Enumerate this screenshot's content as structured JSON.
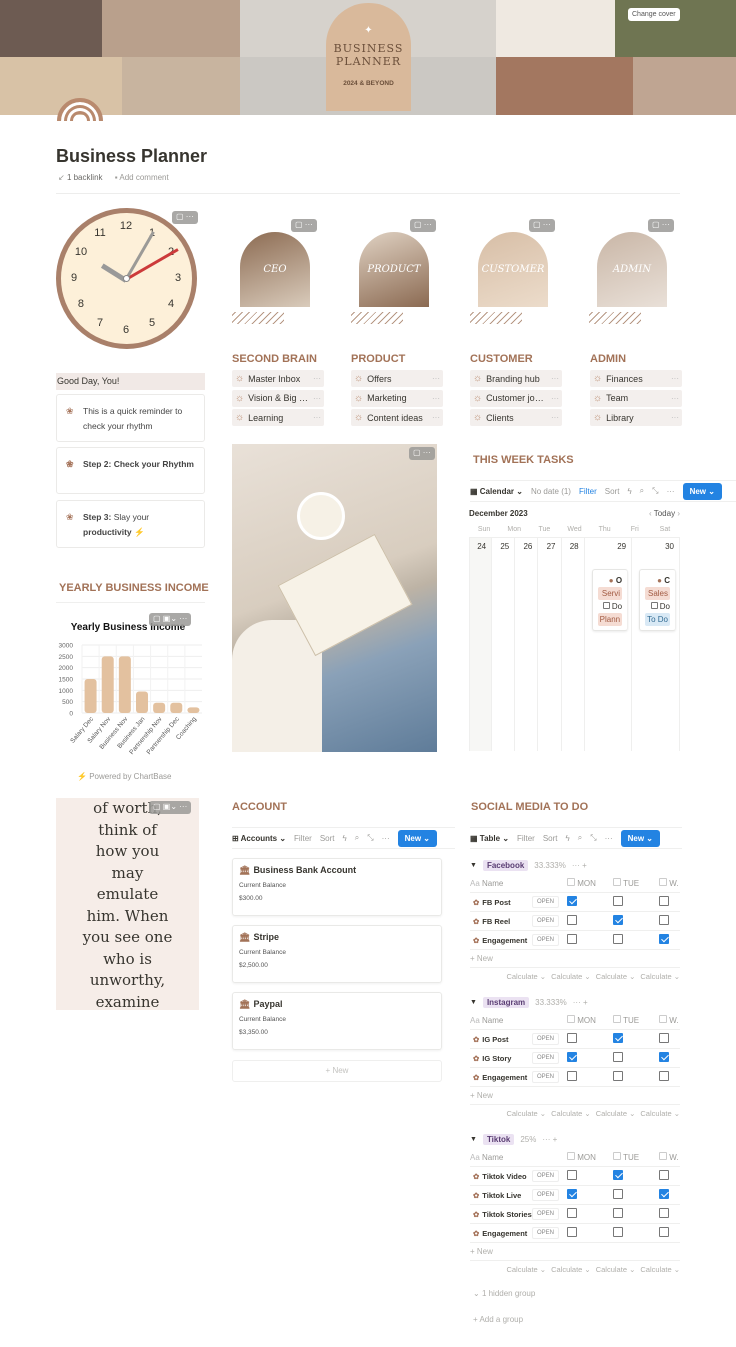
{
  "cover": {
    "badge_title": "BUSINESS PLANNER",
    "badge_subtitle": "2024 & BEYOND",
    "change_cover": "Change cover"
  },
  "page": {
    "title": "Business Planner",
    "backlinks": "1 backlink",
    "add_comment": "Add comment"
  },
  "clock": {
    "numbers": [
      "12",
      "1",
      "2",
      "3",
      "4",
      "5",
      "6",
      "7",
      "8",
      "9",
      "10",
      "11"
    ]
  },
  "categories": [
    {
      "image_label": "CEO",
      "heading": "SECOND BRAIN",
      "items": [
        "Master Inbox",
        "Vision & Big Goals",
        "Learning"
      ]
    },
    {
      "image_label": "PRODUCT",
      "heading": "PRODUCT",
      "items": [
        "Offers",
        "Marketing",
        "Content ideas"
      ]
    },
    {
      "image_label": "CUSTOMER",
      "heading": "CUSTOMER",
      "items": [
        "Branding hub",
        "Customer journey",
        "Clients"
      ]
    },
    {
      "image_label": "ADMIN",
      "heading": "ADMIN",
      "items": [
        "Finances",
        "Team",
        "Library"
      ]
    }
  ],
  "greeting": {
    "title": "Good Day, You!",
    "cards": [
      {
        "text": "This is a quick reminder to check your rhythm"
      },
      {
        "bold": "Step 2: Check your Rhythm"
      },
      {
        "bold": "Step 3:",
        "text": " Slay your ",
        "bold2": "productivity",
        "emoji": "⚡"
      }
    ]
  },
  "tasks": {
    "heading": "THIS WEEK TASKS",
    "view": "Calendar",
    "no_date": "No date (1)",
    "filter": "Filter",
    "sort": "Sort",
    "new": "New",
    "month": "December 2023",
    "today": "Today",
    "weekdays": [
      "Sun",
      "Mon",
      "Tue",
      "Wed",
      "Thu",
      "Fri",
      "Sat"
    ],
    "dates": [
      "24",
      "25",
      "26",
      "27",
      "28",
      "29",
      "30"
    ],
    "events": [
      {
        "day": "29",
        "title": "O",
        "tag": "Servi",
        "todo": "Do",
        "status": "Plann"
      },
      {
        "day": "30",
        "title": "C",
        "tag": "Sales",
        "todo": "Do",
        "status": "To Do"
      }
    ]
  },
  "income": {
    "heading": "YEARLY BUSINESS INCOME",
    "powered": "Powered by ChartBase"
  },
  "chart_data": {
    "type": "bar",
    "title": "Yearly Business Income",
    "categories": [
      "Salary Dec",
      "Salary Nov",
      "Business Nov",
      "Business Jan",
      "Partnership Nov",
      "Partnership Dec",
      "Coaching"
    ],
    "values": [
      1500,
      2500,
      2500,
      950,
      450,
      450,
      250
    ],
    "ylim": [
      0,
      3000
    ],
    "yticks": [
      0,
      500,
      1000,
      1500,
      2000,
      2500,
      3000
    ],
    "grid": true,
    "color": "#e3c19f"
  },
  "quote": {
    "lines": [
      "of worth,",
      "think of",
      "how you",
      "may",
      "emulate",
      "him. When",
      "you see one",
      "who is",
      "unworthy,",
      "examine"
    ]
  },
  "account": {
    "heading": "ACCOUNT",
    "view": "Accounts",
    "filter": "Filter",
    "sort": "Sort",
    "new": "New",
    "new_row": "+ New",
    "cards": [
      {
        "name": "Business Bank Account",
        "label": "Current Balance",
        "value": "$300.00"
      },
      {
        "name": "Stripe",
        "label": "Current Balance",
        "value": "$2,500.00"
      },
      {
        "name": "Paypal",
        "label": "Current Balance",
        "value": "$3,350.00"
      }
    ]
  },
  "social": {
    "heading": "SOCIAL MEDIA TO DO",
    "view": "Table",
    "filter": "Filter",
    "sort": "Sort",
    "new": "New",
    "col_name": "Name",
    "cols": [
      "MON",
      "TUE",
      "W."
    ],
    "open": "OPEN",
    "add_new": "+ New",
    "calculate": "Calculate ⌄",
    "hidden_group": "1 hidden group",
    "add_group": "Add a group",
    "groups": [
      {
        "name": "Facebook",
        "percent": "33.333%",
        "rows": [
          {
            "name": "FB Post",
            "checks": [
              true,
              false,
              false
            ]
          },
          {
            "name": "FB Reel",
            "checks": [
              false,
              true,
              false
            ]
          },
          {
            "name": "Engagement",
            "checks": [
              false,
              false,
              true
            ]
          }
        ]
      },
      {
        "name": "Instagram",
        "percent": "33.333%",
        "rows": [
          {
            "name": "IG Post",
            "checks": [
              false,
              true,
              false
            ]
          },
          {
            "name": "IG Story",
            "checks": [
              true,
              false,
              true
            ]
          },
          {
            "name": "Engagement",
            "checks": [
              false,
              false,
              false
            ]
          }
        ]
      },
      {
        "name": "Tiktok",
        "percent": "25%",
        "rows": [
          {
            "name": "Tiktok Video",
            "checks": [
              false,
              true,
              false
            ]
          },
          {
            "name": "Tiktok Live",
            "checks": [
              true,
              false,
              true
            ]
          },
          {
            "name": "Tiktok Stories",
            "checks": [
              false,
              false,
              false
            ]
          },
          {
            "name": "Engagement",
            "checks": [
              false,
              false,
              false
            ]
          }
        ]
      }
    ]
  },
  "colors": {
    "accent": "#a27257",
    "blue": "#2383e2"
  }
}
